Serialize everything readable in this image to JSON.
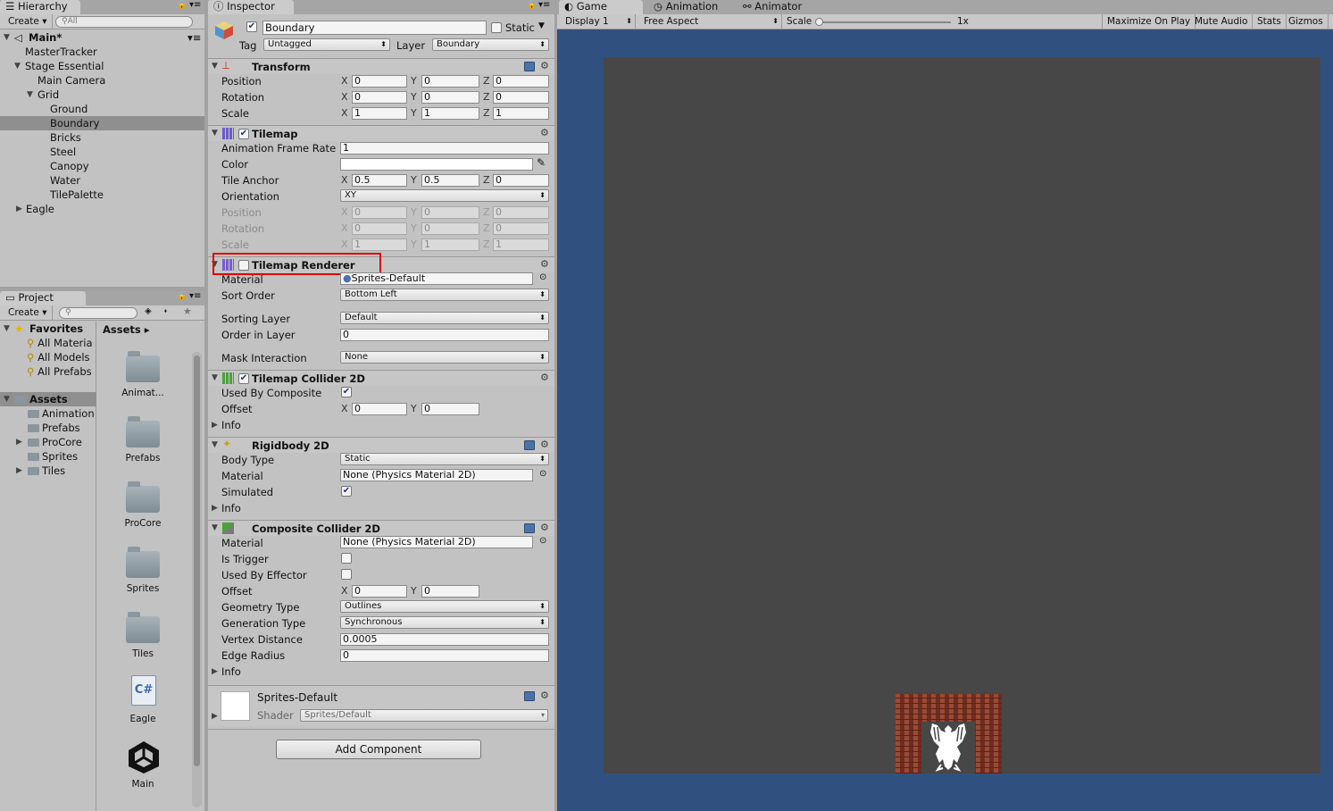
{
  "hierarchy": {
    "tab_label": "Hierarchy",
    "create_label": "Create",
    "search_placeholder": "All",
    "scene_name": "Main*",
    "items": [
      "MasterTracker",
      "Stage Essential",
      "Main Camera",
      "Grid",
      "Ground",
      "Boundary",
      "Bricks",
      "Steel",
      "Canopy",
      "Water",
      "TilePalette",
      "Eagle"
    ]
  },
  "project": {
    "tab_label": "Project",
    "create_label": "Create",
    "favorites_label": "Favorites",
    "favorites": [
      "All Materia",
      "All Models",
      "All Prefabs"
    ],
    "assets_root": "Assets",
    "asset_folders": [
      "Animation",
      "Prefabs",
      "ProCore",
      "Sprites",
      "Tiles"
    ],
    "breadcrumb": "Assets",
    "grid_items": [
      "Animat...",
      "Prefabs",
      "ProCore",
      "Sprites",
      "Tiles",
      "Eagle",
      "Main"
    ]
  },
  "inspector": {
    "tab_label": "Inspector",
    "object_name": "Boundary",
    "static_label": "Static",
    "tag_label": "Tag",
    "tag_value": "Untagged",
    "layer_label": "Layer",
    "layer_value": "Boundary",
    "transform": {
      "title": "Transform",
      "rows": [
        {
          "label": "Position",
          "x": "0",
          "y": "0",
          "z": "0"
        },
        {
          "label": "Rotation",
          "x": "0",
          "y": "0",
          "z": "0"
        },
        {
          "label": "Scale",
          "x": "1",
          "y": "1",
          "z": "1"
        }
      ]
    },
    "tilemap": {
      "title": "Tilemap",
      "frame_rate_label": "Animation Frame Rate",
      "frame_rate": "1",
      "color_label": "Color",
      "anchor_label": "Tile Anchor",
      "anchor": {
        "x": "0.5",
        "y": "0.5",
        "z": "0"
      },
      "orientation_label": "Orientation",
      "orientation": "XY",
      "rows": [
        {
          "label": "Position",
          "x": "0",
          "y": "0",
          "z": "0"
        },
        {
          "label": "Rotation",
          "x": "0",
          "y": "0",
          "z": "0"
        },
        {
          "label": "Scale",
          "x": "1",
          "y": "1",
          "z": "1"
        }
      ]
    },
    "tilemap_renderer": {
      "title": "Tilemap Renderer",
      "material_label": "Material",
      "material": "Sprites-Default",
      "sort_order_label": "Sort Order",
      "sort_order": "Bottom Left",
      "sorting_layer_label": "Sorting Layer",
      "sorting_layer": "Default",
      "order_label": "Order in Layer",
      "order": "0",
      "mask_label": "Mask Interaction",
      "mask": "None"
    },
    "tilemap_collider": {
      "title": "Tilemap Collider 2D",
      "composite_label": "Used By Composite",
      "offset_label": "Offset",
      "offset": {
        "x": "0",
        "y": "0"
      },
      "info_label": "Info"
    },
    "rigidbody": {
      "title": "Rigidbody 2D",
      "body_type_label": "Body Type",
      "body_type": "Static",
      "material_label": "Material",
      "material": "None (Physics Material 2D)",
      "simulated_label": "Simulated",
      "info_label": "Info"
    },
    "composite": {
      "title": "Composite Collider 2D",
      "material_label": "Material",
      "material": "None (Physics Material 2D)",
      "trigger_label": "Is Trigger",
      "effector_label": "Used By Effector",
      "offset_label": "Offset",
      "offset": {
        "x": "0",
        "y": "0"
      },
      "geometry_label": "Geometry Type",
      "geometry": "Outlines",
      "generation_label": "Generation Type",
      "generation": "Synchronous",
      "vertex_label": "Vertex Distance",
      "vertex": "0.0005",
      "edge_label": "Edge Radius",
      "edge": "0",
      "info_label": "Info"
    },
    "material_preview": {
      "name": "Sprites-Default",
      "shader_label": "Shader",
      "shader": "Sprites/Default"
    },
    "add_component": "Add Component"
  },
  "game": {
    "tabs": [
      "Game",
      "Animation",
      "Animator"
    ],
    "display": "Display 1",
    "aspect": "Free Aspect",
    "scale_label": "Scale",
    "scale_value": "1x",
    "buttons": [
      "Maximize On Play",
      "Mute Audio",
      "Stats",
      "Gizmos"
    ]
  },
  "colors": {
    "game_bg": "#30517f",
    "viewport": "#474747",
    "brick": "#8a3a28",
    "highlight": "#e00000"
  }
}
